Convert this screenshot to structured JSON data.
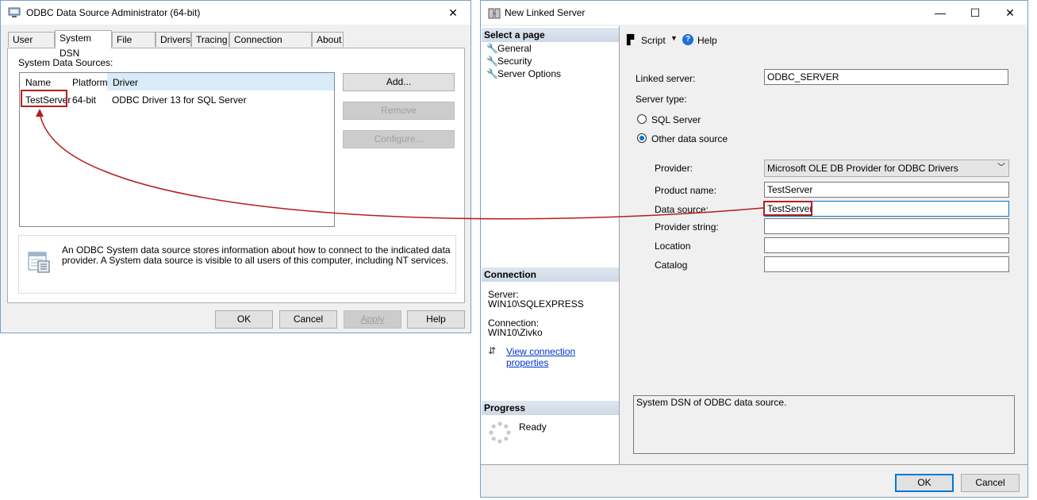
{
  "odbc": {
    "title": "ODBC Data Source Administrator (64-bit)",
    "tabs": [
      "User DSN",
      "System DSN",
      "File DSN",
      "Drivers",
      "Tracing",
      "Connection Pooling",
      "About"
    ],
    "group_label": "System Data Sources:",
    "columns": [
      "Name",
      "Platform",
      "Driver"
    ],
    "rows": [
      {
        "name": "TestServer",
        "platform": "64-bit",
        "driver": "ODBC Driver 13 for SQL Server"
      }
    ],
    "buttons": {
      "add": "Add...",
      "remove": "Remove",
      "configure": "Configure..."
    },
    "info_text": "An ODBC System data source stores information about how to connect to the indicated data provider. A System data source is visible to all users of this computer, including NT services.",
    "footer": {
      "ok": "OK",
      "cancel": "Cancel",
      "apply": "Apply",
      "help": "Help"
    }
  },
  "linked": {
    "title": "New Linked Server",
    "select_page": "Select a page",
    "pages": [
      "General",
      "Security",
      "Server Options"
    ],
    "toolbar": {
      "script": "Script",
      "help": "Help"
    },
    "connection": {
      "header": "Connection",
      "server_label": "Server:",
      "server_value": "WIN10\\SQLEXPRESS",
      "connection_label": "Connection:",
      "connection_value": "WIN10\\Zivko",
      "view_link": "View connection properties"
    },
    "progress": {
      "header": "Progress",
      "status": "Ready"
    },
    "form": {
      "linked_server_label": "Linked server:",
      "linked_server_value": "ODBC_SERVER",
      "server_type_label": "Server type:",
      "sql_server_option": "SQL Server",
      "other_source_option": "Other data source",
      "provider_label": "Provider:",
      "provider_value": "Microsoft OLE DB Provider for ODBC Drivers",
      "product_name_label": "Product name:",
      "product_name_value": "TestServer",
      "data_source_label": "Data source:",
      "data_source_value": "TestServer",
      "provider_string_label": "Provider string:",
      "provider_string_value": "",
      "location_label": "Location",
      "location_value": "",
      "catalog_label": "Catalog",
      "catalog_value": ""
    },
    "description": "System DSN of ODBC data source.",
    "footer": {
      "ok": "OK",
      "cancel": "Cancel"
    }
  },
  "colors": {
    "annotation": "#b41e1e",
    "accent": "#0078d7"
  }
}
